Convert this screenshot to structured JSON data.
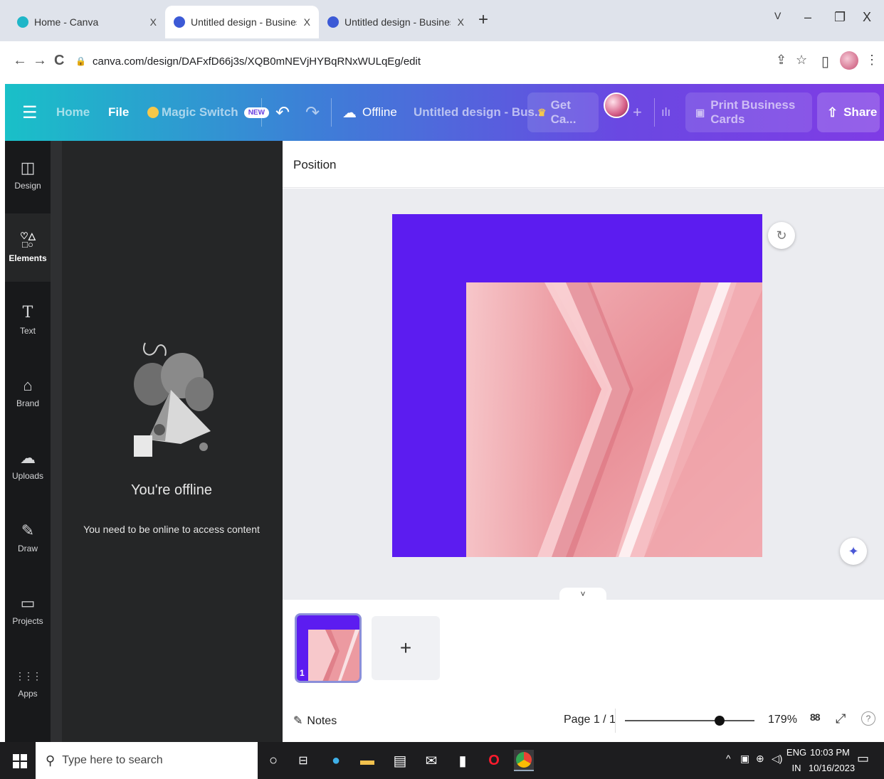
{
  "browser": {
    "tabs": [
      {
        "title": "Home - Canva",
        "close": "X"
      },
      {
        "title": "Untitled design - Business Card",
        "close": "X"
      },
      {
        "title": "Untitled design - Business Card",
        "close": "X"
      }
    ],
    "new_tab": "+",
    "window_controls": {
      "dropdown": "V",
      "minimize": "–",
      "restore": "❐",
      "close": "X"
    },
    "url": "canva.com/design/DAFxfD66j3s/XQB0mNEVjHYBqRNxWULqEg/edit",
    "nav": {
      "back": "←",
      "forward": "→",
      "reload": "C"
    }
  },
  "toolbar": {
    "menu_icon": "☰",
    "home": "Home",
    "file": "File",
    "magic_switch": "Magic Switch",
    "new_badge": "NEW",
    "undo": "↶",
    "redo": "↷",
    "offline": "Offline",
    "doc_title": "Untitled design - Bus...",
    "get_canva": "Get Ca...",
    "add_people": "+",
    "insights_icon": "ılı",
    "print": "Print Business Cards",
    "share": "Share"
  },
  "sidebar": {
    "items": [
      {
        "label": "Design",
        "icon": "◫"
      },
      {
        "label": "Elements",
        "icon": "♡△\n□○"
      },
      {
        "label": "Text",
        "icon": "T"
      },
      {
        "label": "Brand",
        "icon": "⌂"
      },
      {
        "label": "Uploads",
        "icon": "☁"
      },
      {
        "label": "Draw",
        "icon": "✎"
      },
      {
        "label": "Projects",
        "icon": "▭"
      },
      {
        "label": "Apps",
        "icon": "⋮⋮⋮"
      }
    ]
  },
  "panel": {
    "title": "You're offline",
    "description": "You need to be online to access content",
    "collapse": "‹"
  },
  "editor": {
    "position_label": "Position",
    "refresh_icon": "↻",
    "magic_icon": "✦",
    "expand": "˅",
    "colors": {
      "card_bg": "#5c1cf0",
      "accent": "#7d2ae8"
    }
  },
  "pages": {
    "thumb_number": "1",
    "add_page": "+"
  },
  "footer": {
    "notes": "Notes",
    "page": "Page 1 / 1",
    "zoom": "179%",
    "zoom_fraction": 0.73,
    "grid_icon": "88",
    "fullscreen_icon": "⤢",
    "help_icon": "?"
  },
  "taskbar": {
    "search_placeholder": "Type here to search",
    "lang": "ENG",
    "region": "IN",
    "time": "10:03 PM",
    "date": "10/16/2023"
  }
}
